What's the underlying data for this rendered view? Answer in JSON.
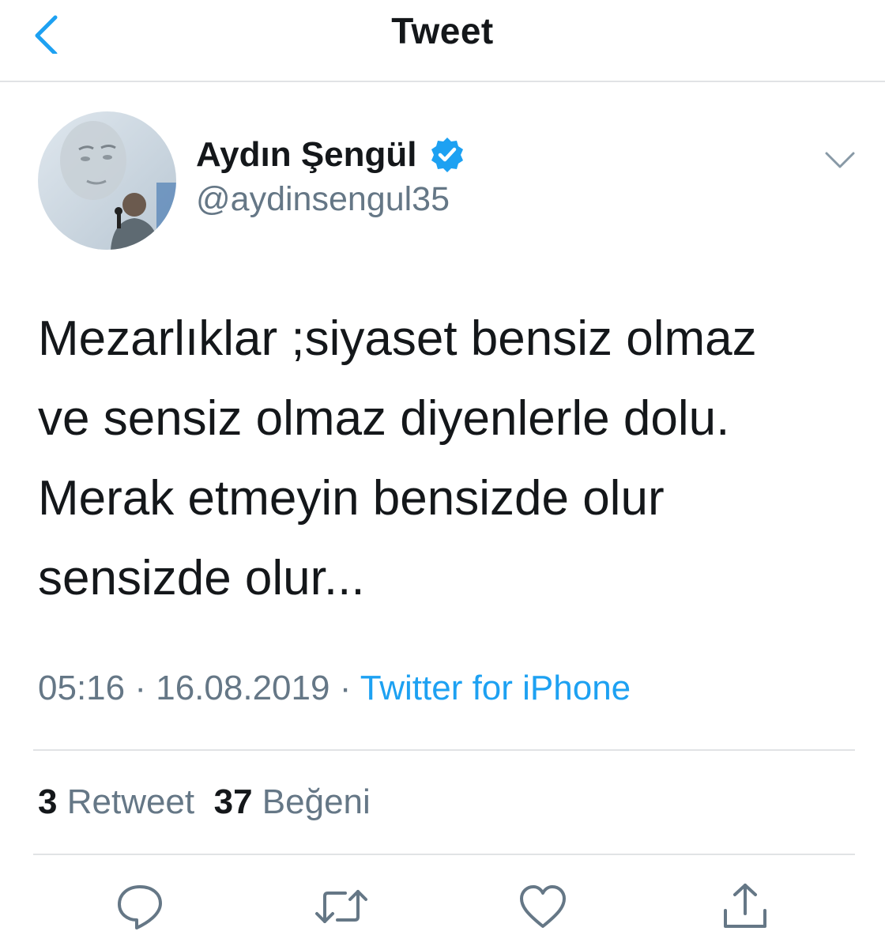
{
  "header": {
    "title": "Tweet",
    "back_icon": "chevron-left-icon"
  },
  "author": {
    "name": "Aydın Şengül",
    "handle": "@aydinsengul35",
    "verified": true
  },
  "tweet": {
    "text_lines": [
      "Mezarlıklar ;siyaset bensiz olmaz",
      "ve sensiz olmaz diyenlerle dolu.",
      "Merak etmeyin bensizde olur",
      "sensizde olur..."
    ],
    "time": "05:16",
    "separator": "·",
    "date": "16.08.2019",
    "source": "Twitter for iPhone"
  },
  "stats": {
    "retweet_count": "3",
    "retweet_label": "Retweet",
    "like_count": "37",
    "like_label": "Beğeni"
  },
  "actions": [
    "reply-icon",
    "retweet-icon",
    "like-icon",
    "share-icon"
  ],
  "colors": {
    "accent": "#1da1f2",
    "text": "#14171a",
    "secondary_text": "#657786",
    "divider": "#e1e3e5"
  }
}
